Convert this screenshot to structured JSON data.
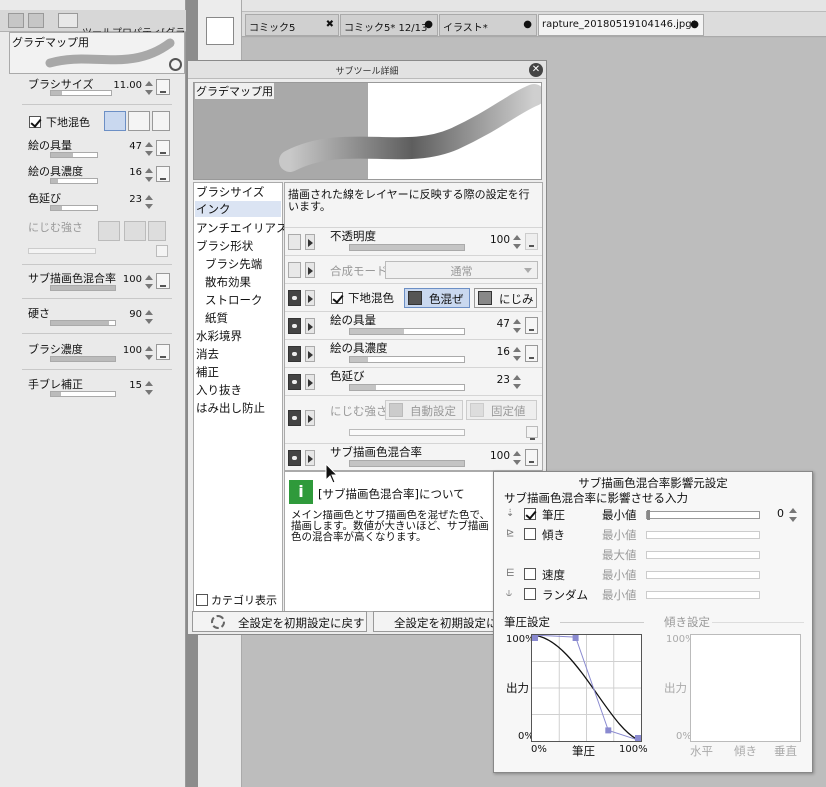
{
  "tool_property": {
    "title": "ツールプロパティ[グラデマッ",
    "preview_label": "グラデマップ用",
    "items": [
      {
        "label": "ブラシサイズ",
        "value": "11.00",
        "level": 0.18
      },
      {
        "label": "下地混色",
        "checked": true
      },
      {
        "label": "絵の具量",
        "value": "47",
        "level": 0.47
      },
      {
        "label": "絵の具濃度",
        "value": "16",
        "level": 0.16
      },
      {
        "label": "色延び",
        "value": "23",
        "level": 0.23
      },
      {
        "label": "にじむ強さ",
        "disabled": true
      },
      {
        "label": "サブ描画色混合率",
        "value": "100",
        "level": 1.0
      },
      {
        "label": "硬さ",
        "value": "90",
        "level": 0.9
      },
      {
        "label": "ブラシ濃度",
        "value": "100",
        "level": 1.0
      },
      {
        "label": "手ブレ補正",
        "value": "15",
        "level": 0.15
      }
    ]
  },
  "doc_tabs": [
    {
      "label": "コミック5",
      "close": "✖"
    },
    {
      "label": "コミック5*  12/13",
      "close": "●"
    },
    {
      "label": "イラスト*",
      "close": "●"
    },
    {
      "label": "rapture_20180519104146.jpg*",
      "close": "●",
      "active": true
    }
  ],
  "dialog": {
    "title": "サブツール詳細",
    "close_icon": "close-icon",
    "preview_label": "グラデマップ用",
    "categories": [
      {
        "label": "ブラシサイズ"
      },
      {
        "label": "インク",
        "selected": true
      },
      {
        "label": "アンチエイリアス"
      },
      {
        "label": "ブラシ形状"
      },
      {
        "label": "ブラシ先端",
        "sub": true
      },
      {
        "label": "散布効果",
        "sub": true
      },
      {
        "label": "ストローク",
        "sub": true
      },
      {
        "label": "紙質",
        "sub": true
      },
      {
        "label": "水彩境界"
      },
      {
        "label": "消去"
      },
      {
        "label": "補正"
      },
      {
        "label": "入り抜き"
      },
      {
        "label": "はみ出し防止"
      }
    ],
    "category_checkbox": "カテゴリ表示",
    "description": "描画された線をレイヤーに反映する際の設定を行います。",
    "settings": {
      "opacity": {
        "label": "不透明度",
        "value": "100",
        "level": 1.0
      },
      "blend": {
        "label": "合成モード",
        "value": "通常"
      },
      "underlay": {
        "label": "下地混色",
        "checked": true,
        "mix": "色混ぜ",
        "bleed": "にじみ"
      },
      "paint_amount": {
        "label": "絵の具量",
        "value": "47",
        "level": 0.47
      },
      "paint_density": {
        "label": "絵の具濃度",
        "value": "16",
        "level": 0.16
      },
      "color_stretch": {
        "label": "色延び",
        "value": "23",
        "level": 0.23
      },
      "bleed_strength": {
        "label": "にじむ強さ",
        "auto": "自動設定",
        "fixed": "固定値"
      },
      "sub_color_mix": {
        "label": "サブ描画色混合率",
        "value": "100",
        "level": 1.0
      }
    },
    "info": {
      "title": "[サブ描画色混合率]について",
      "text": "メイン描画色とサブ描画色を混ぜた色で、描画します。数値が大きいほど、サブ描画色の混合率が高くなります。"
    },
    "reset_button": "全設定を初期設定に戻す",
    "reset_button2": "全設定を初期設定に登録"
  },
  "popup": {
    "title": "サブ描画色混合率影響元設定",
    "subtitle": "サブ描画色混合率に影響させる入力",
    "rows": [
      {
        "label": "筆圧",
        "checked": true,
        "min_label": "最小値",
        "value": "0",
        "active": true
      },
      {
        "label": "傾き",
        "checked": false,
        "min_label": "最小値"
      },
      {
        "label": "",
        "checked": false,
        "min_label": "最大値"
      },
      {
        "label": "速度",
        "checked": false,
        "min_label": "最小値"
      },
      {
        "label": "ランダム",
        "checked": false,
        "min_label": "最小値"
      }
    ],
    "pressure_title": "筆圧設定",
    "tilt_title": "傾き設定",
    "curve": {
      "ylabel": "出力",
      "xlabel": "筆圧",
      "y_top": "100%",
      "y_bottom": "0%",
      "x_left": "0%",
      "x_right": "100%",
      "points": [
        [
          0,
          100
        ],
        [
          40,
          98
        ],
        [
          70,
          10
        ],
        [
          100,
          0
        ]
      ]
    },
    "tilt": {
      "ylabel": "出力",
      "y_top": "100%",
      "y_bottom": "0%",
      "x_labels": [
        "水平",
        "傾き",
        "垂直"
      ]
    }
  }
}
